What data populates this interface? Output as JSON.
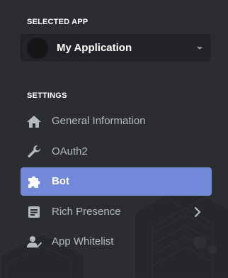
{
  "selected_app": {
    "section_title": "SELECTED APP",
    "app_name": "My Application"
  },
  "settings": {
    "section_title": "SETTINGS",
    "items": [
      {
        "label": "General Information",
        "icon": "home-icon",
        "active": false
      },
      {
        "label": "OAuth2",
        "icon": "wrench-icon",
        "active": false
      },
      {
        "label": "Bot",
        "icon": "puzzle-icon",
        "active": true
      },
      {
        "label": "Rich Presence",
        "icon": "document-icon",
        "active": false,
        "has_submenu": true
      },
      {
        "label": "App Whitelist",
        "icon": "user-check-icon",
        "active": false
      }
    ]
  },
  "colors": {
    "background": "#2b2d31",
    "active_item": "#7289da",
    "text_muted": "#b5bac1",
    "text_primary": "#ffffff"
  }
}
